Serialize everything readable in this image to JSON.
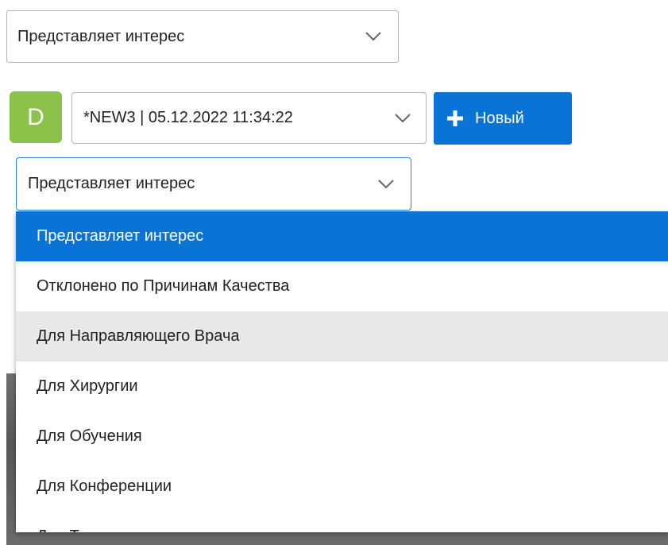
{
  "status_select_top": {
    "value": "Представляет интерес",
    "icon": "chevron-down-icon"
  },
  "avatar": {
    "letter": "D",
    "color": "#8bc34a"
  },
  "record_select": {
    "value": "*NEW3 | 05.12.2022 11:34:22",
    "icon": "chevron-down-icon"
  },
  "new_button": {
    "label": "Новый",
    "icon": "plus-icon",
    "color": "#0a73d6"
  },
  "status_select": {
    "value": "Представляет интерес",
    "icon": "chevron-down-icon"
  },
  "dropdown": {
    "selected_index": 0,
    "hover_index": 2,
    "options": [
      "Представляет интерес",
      "Отклонено по Причинам Качества",
      "Для Направляющего Врача",
      "Для Хирургии",
      "Для Обучения",
      "Для Конференции",
      "Для Т..."
    ]
  },
  "colors": {
    "accent": "#0a73d6",
    "focus_border": "#2a85d8",
    "hover": "#e8e8e8"
  }
}
